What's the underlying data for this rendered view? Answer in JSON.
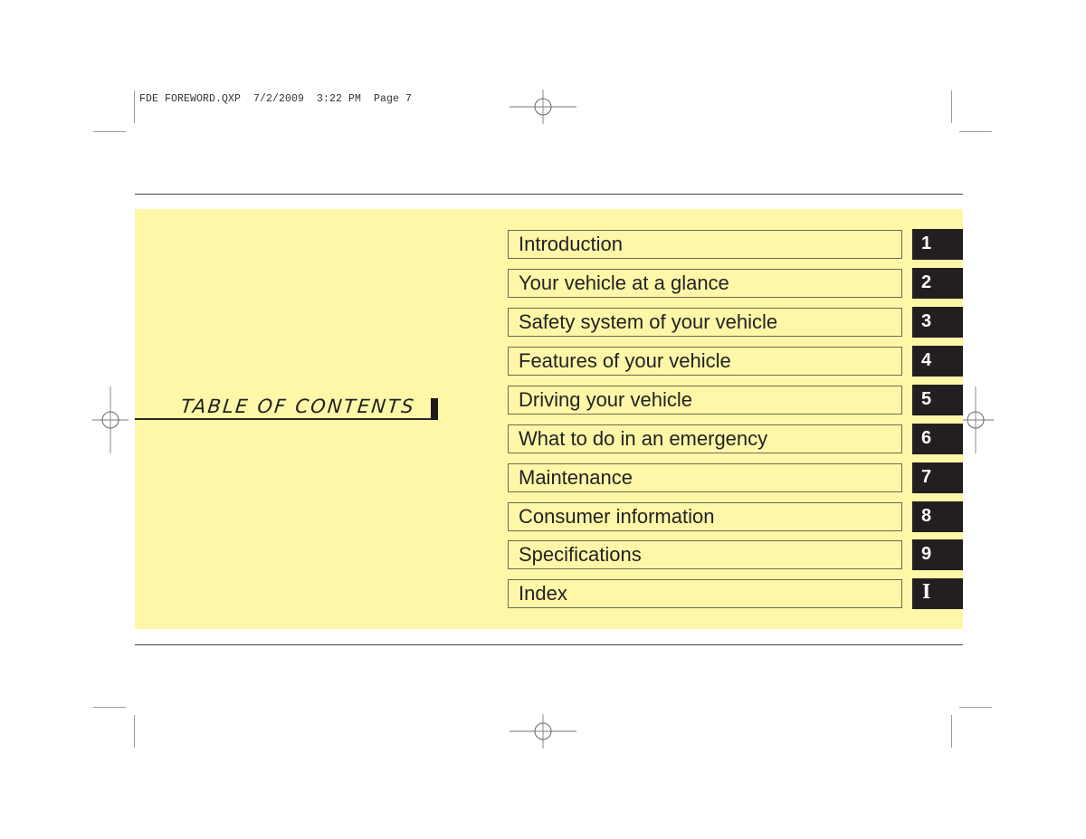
{
  "print_slug": "FDE FOREWORD.QXP  7/2/2009  3:22 PM  Page 7",
  "heading": {
    "title": "TABLE OF CONTENTS"
  },
  "chapters": [
    {
      "label": "Introduction",
      "tab": "1"
    },
    {
      "label": "Your vehicle at a glance",
      "tab": "2"
    },
    {
      "label": "Safety system of your vehicle",
      "tab": "3"
    },
    {
      "label": "Features of your vehicle",
      "tab": "4"
    },
    {
      "label": "Driving your vehicle",
      "tab": "5"
    },
    {
      "label": "What to do in an emergency",
      "tab": "6"
    },
    {
      "label": "Maintenance",
      "tab": "7"
    },
    {
      "label": "Consumer information",
      "tab": "8"
    },
    {
      "label": "Specifications",
      "tab": "9"
    },
    {
      "label": "Index",
      "tab": "I"
    }
  ],
  "colors": {
    "panel": "#fff7a8",
    "tab": "#231f20",
    "tab_text": "#ffffff"
  }
}
